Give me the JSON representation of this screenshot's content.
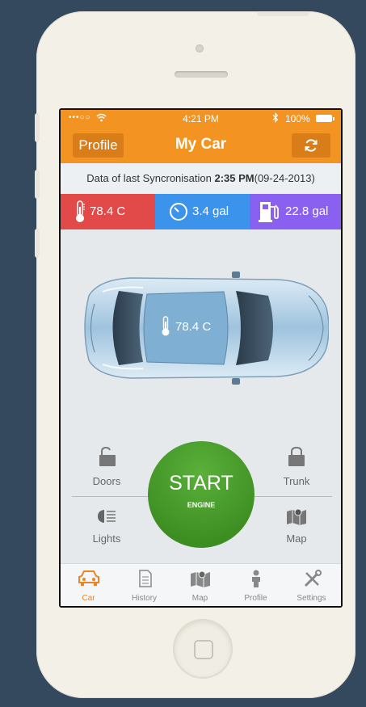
{
  "status_bar": {
    "signal": "•••○○",
    "time": "4:21 PM",
    "battery": "100%"
  },
  "nav": {
    "left_button": "Profile",
    "title": "My Car"
  },
  "sync": {
    "prefix": "Data of last Syncronisation",
    "time": "2:35 PM",
    "date": "(09-24-2013)"
  },
  "stats": [
    {
      "icon": "thermometer-icon",
      "value": "78.4 C",
      "color": "#e24a4a"
    },
    {
      "icon": "gauge-icon",
      "value": "3.4 gal",
      "color": "#3c93ec"
    },
    {
      "icon": "fuel-pump-icon",
      "value": "22.8 gal",
      "color": "#8960f0"
    }
  ],
  "car": {
    "temperature": "78.4 C"
  },
  "controls": {
    "doors": "Doors",
    "trunk": "Trunk",
    "lights": "Lights",
    "map": "Map"
  },
  "start": {
    "label": "START",
    "sublabel": "ENGINE"
  },
  "tabs": [
    {
      "label": "Car",
      "icon": "car-icon",
      "active": true
    },
    {
      "label": "History",
      "icon": "document-icon",
      "active": false
    },
    {
      "label": "Map",
      "icon": "map-icon",
      "active": false
    },
    {
      "label": "Profile",
      "icon": "person-icon",
      "active": false
    },
    {
      "label": "Settings",
      "icon": "tools-icon",
      "active": false
    }
  ],
  "colors": {
    "accent": "#f39422",
    "background": "#34495e",
    "start": "#3d8e22"
  }
}
